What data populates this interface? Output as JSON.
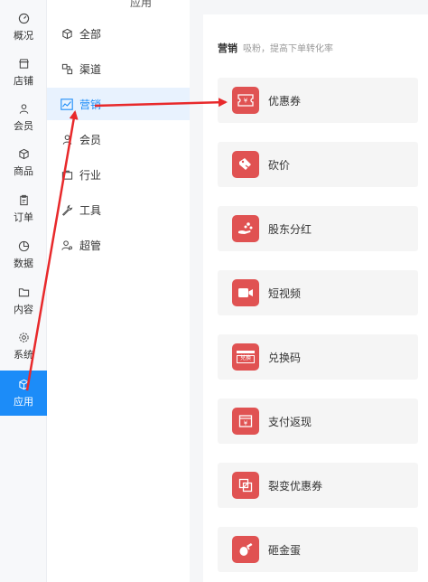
{
  "rail": {
    "items": [
      {
        "label": "概况",
        "icon": "dashboard-icon"
      },
      {
        "label": "店铺",
        "icon": "store-icon"
      },
      {
        "label": "会员",
        "icon": "user-icon"
      },
      {
        "label": "商品",
        "icon": "box-icon"
      },
      {
        "label": "订单",
        "icon": "clipboard-icon"
      },
      {
        "label": "数据",
        "icon": "pie-chart-icon"
      },
      {
        "label": "内容",
        "icon": "folder-icon"
      },
      {
        "label": "系统",
        "icon": "gear-icon"
      },
      {
        "label": "应用",
        "icon": "cube-icon",
        "active": true
      }
    ]
  },
  "submenu": {
    "title": "应用",
    "items": [
      {
        "label": "全部",
        "icon": "cube-icon"
      },
      {
        "label": "渠道",
        "icon": "channel-icon"
      },
      {
        "label": "营销",
        "icon": "trend-icon",
        "active": true
      },
      {
        "label": "会员",
        "icon": "user-icon"
      },
      {
        "label": "行业",
        "icon": "briefcase-icon"
      },
      {
        "label": "工具",
        "icon": "wrench-icon"
      },
      {
        "label": "超管",
        "icon": "admin-icon"
      }
    ]
  },
  "section": {
    "title": "营销",
    "subtitle": "吸粉，提高下单转化率"
  },
  "apps": [
    {
      "label": "优惠券",
      "icon": "coupon-icon"
    },
    {
      "label": "砍价",
      "icon": "price-cut-icon"
    },
    {
      "label": "股东分红",
      "icon": "dividend-icon"
    },
    {
      "label": "短视频",
      "icon": "video-icon"
    },
    {
      "label": "兑换码",
      "icon": "redeem-code-icon",
      "badge_text": "兑换"
    },
    {
      "label": "支付返现",
      "icon": "cashback-icon"
    },
    {
      "label": "裂变优惠券",
      "icon": "fission-coupon-icon"
    },
    {
      "label": "砸金蛋",
      "icon": "golden-egg-icon"
    }
  ],
  "colors": {
    "accent": "#1c8cf8",
    "app_badge": "#e05252",
    "annotation_arrow": "#e8292b"
  }
}
